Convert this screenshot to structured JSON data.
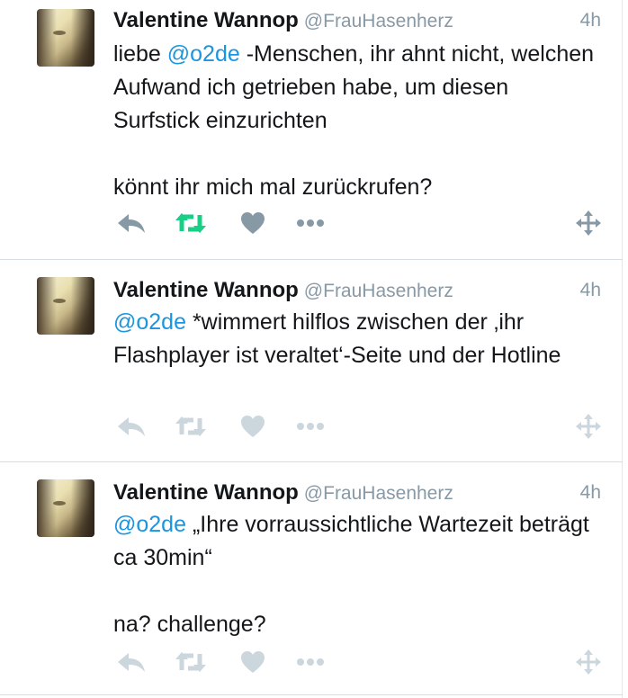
{
  "colors": {
    "name": "#14171a",
    "muted": "#8899a6",
    "mention": "#1b95e0",
    "retweet_active": "#19cf86",
    "action_active": "#8899a6",
    "action_faded": "#ccd6dd",
    "divider": "#d6dde3"
  },
  "icons": [
    "reply-icon",
    "retweet-icon",
    "like-icon",
    "more-icon",
    "move-icon"
  ],
  "tweets": [
    {
      "name": "Valentine Wannop",
      "handle": "@FrauHasenherz",
      "time": "4h",
      "mention": "@o2de",
      "text_before": "liebe ",
      "text_after": " -Menschen, ihr ahnt nicht, welchen Aufwand ich getrieben habe, um diesen Surfstick einzurichten\n\nkönnt ihr mich mal zurückrufen?",
      "retweeted": true,
      "actions_faded": false
    },
    {
      "name": "Valentine Wannop",
      "handle": "@FrauHasenherz",
      "time": "4h",
      "mention": "@o2de",
      "text_before": "",
      "text_after": " *wimmert hilflos zwischen der ‚ihr Flashplayer ist veraltet‘-Seite und der Hotline",
      "retweeted": false,
      "actions_faded": true
    },
    {
      "name": "Valentine Wannop",
      "handle": "@FrauHasenherz",
      "time": "4h",
      "mention": "@o2de",
      "text_before": "",
      "text_after": " „Ihre vorraussichtliche Wartezeit beträgt ca 30min“\n\nna? challenge?",
      "retweeted": false,
      "actions_faded": true
    }
  ]
}
